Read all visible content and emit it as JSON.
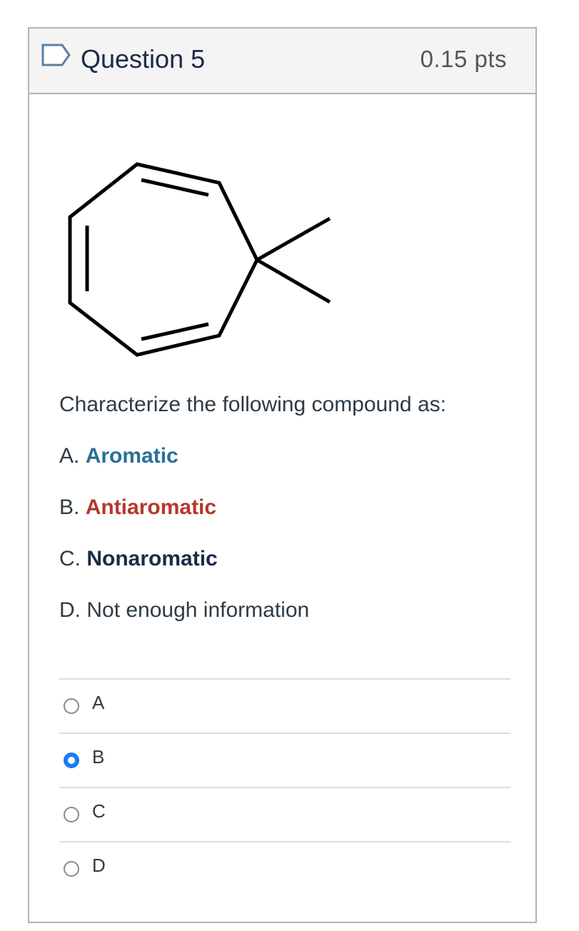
{
  "question": {
    "title": "Question 5",
    "points": "0.15 pts",
    "flag_icon": "flag-outline-icon",
    "prompt": "Characterize the following compound as:",
    "image_alt": "7,7-dimethylcyclohepta-1,3,5-triene skeletal structure",
    "options": [
      {
        "prefix": "A.",
        "word": "Aromatic",
        "color": "#2a6f97"
      },
      {
        "prefix": "B.",
        "word": "Antiaromatic",
        "color": "#b5372e"
      },
      {
        "prefix": "C.",
        "word": "Nonaromatic",
        "color": "#1b2b46"
      },
      {
        "prefix": "D.",
        "word": "Not enough information",
        "color": "#2d3b45"
      }
    ],
    "answers": [
      {
        "label": "A",
        "checked": false
      },
      {
        "label": "B",
        "checked": true
      },
      {
        "label": "C",
        "checked": false
      },
      {
        "label": "D",
        "checked": false
      }
    ],
    "accent_color": "#1a7cf5"
  }
}
